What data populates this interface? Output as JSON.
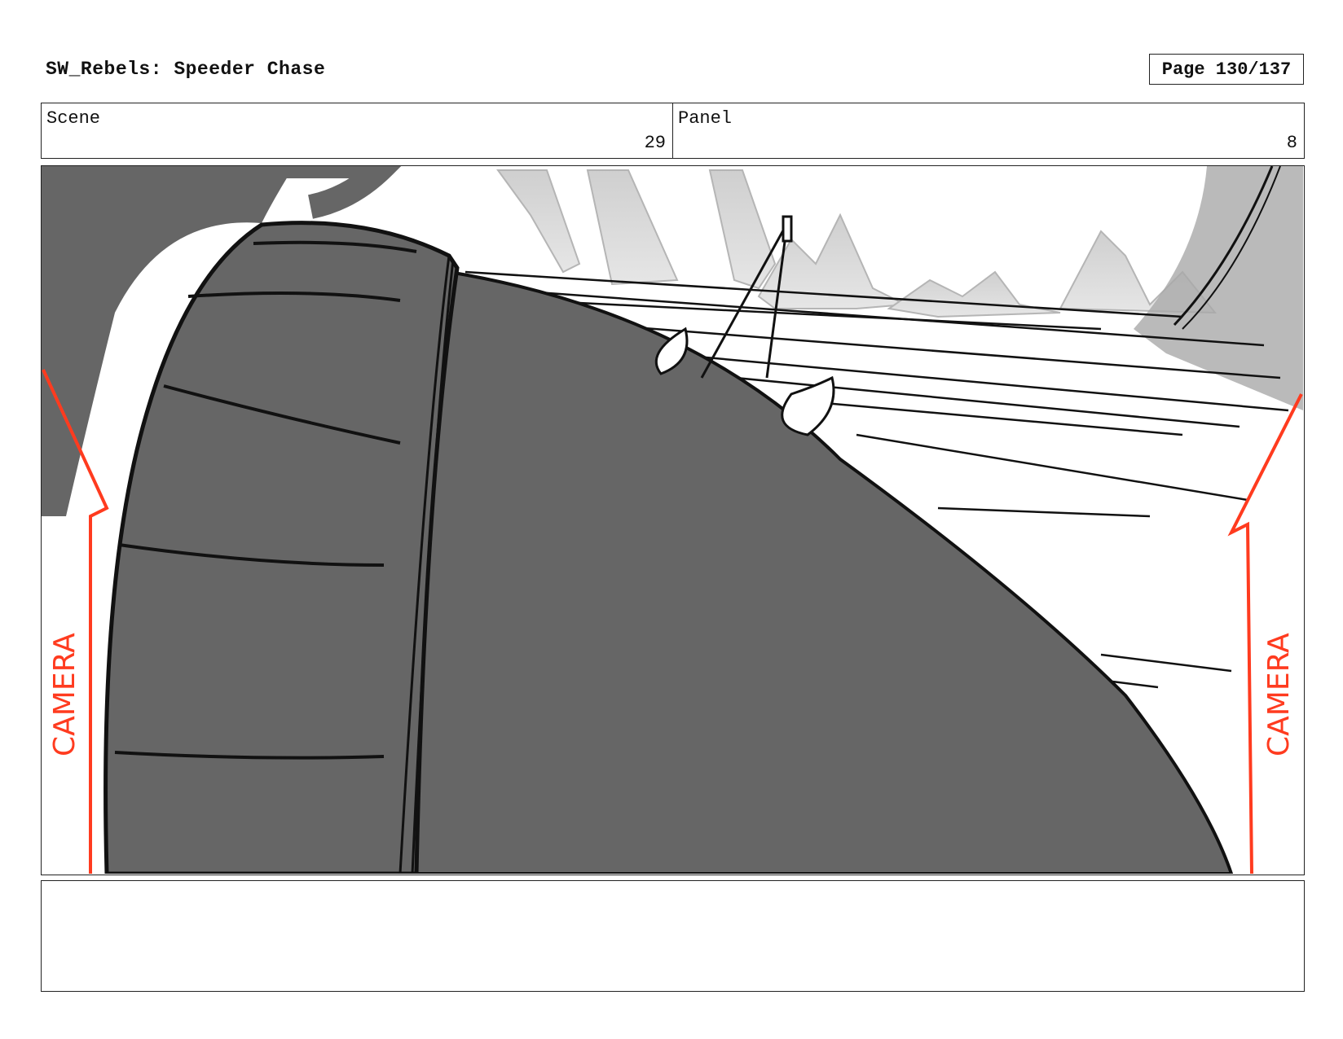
{
  "header": {
    "title": "SW_Rebels: Speeder Chase",
    "page": "Page 130/137"
  },
  "info": {
    "scene_label": "Scene",
    "scene_value": "29",
    "panel_label": "Panel",
    "panel_value": "8"
  },
  "frame": {
    "camera_left": "CAMERA",
    "camera_right": "CAMERA",
    "annotation_color": "#ff3b1f"
  },
  "notes": {
    "text": ""
  }
}
